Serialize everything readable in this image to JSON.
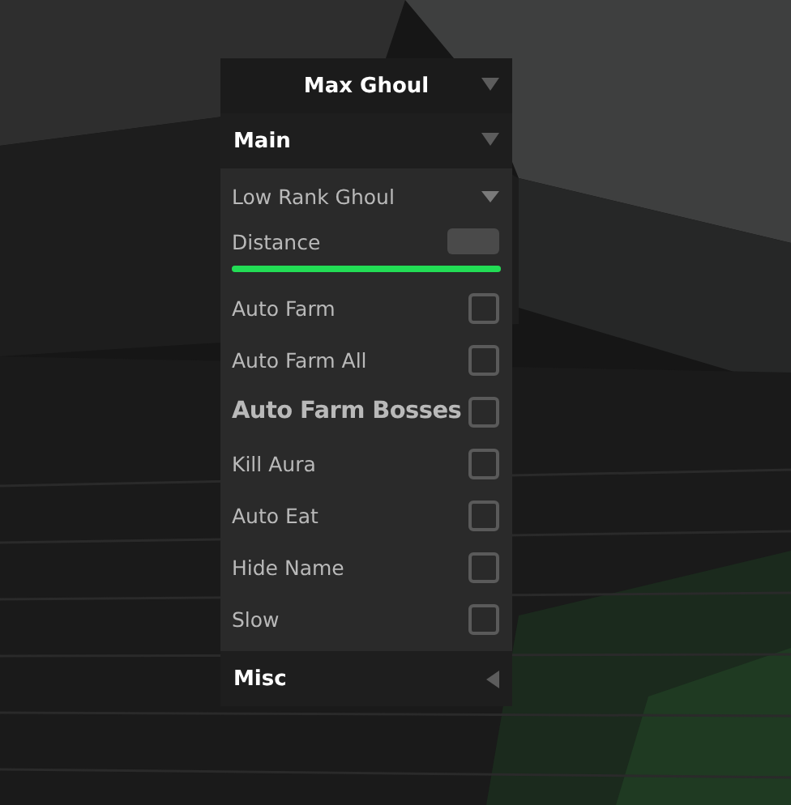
{
  "window": {
    "title": "Max Ghoul",
    "expanded": true
  },
  "sections": [
    {
      "label": "Main",
      "expanded": true,
      "items": [
        {
          "kind": "dropdown",
          "label": "Low Rank Ghoul",
          "expanded": false
        },
        {
          "kind": "slider",
          "label": "Distance",
          "level": 1
        },
        {
          "kind": "toggle",
          "label": "Auto Farm",
          "checked": false,
          "large": false
        },
        {
          "kind": "toggle",
          "label": "Auto Farm All",
          "checked": false,
          "large": false
        },
        {
          "kind": "toggle",
          "label": "Auto Farm Bosses",
          "checked": false,
          "large": true
        },
        {
          "kind": "toggle",
          "label": "Kill Aura",
          "checked": false,
          "large": false
        },
        {
          "kind": "toggle",
          "label": "Auto Eat",
          "checked": false,
          "large": false
        },
        {
          "kind": "toggle",
          "label": "Hide Name",
          "checked": false,
          "large": false
        },
        {
          "kind": "toggle",
          "label": "Slow",
          "checked": false,
          "large": false
        }
      ]
    },
    {
      "label": "Misc",
      "expanded": false
    }
  ]
}
